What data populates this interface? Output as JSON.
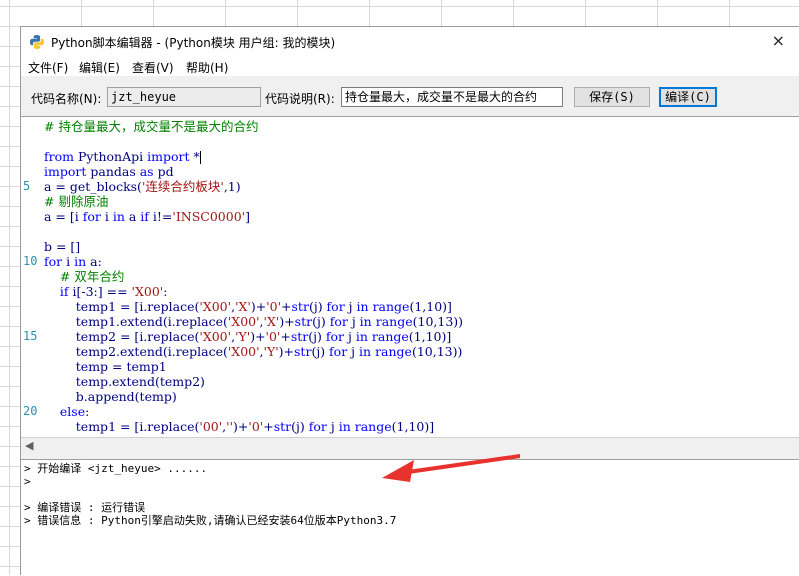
{
  "window": {
    "title": "Python脚本编辑器 - (Python模块 用户组: 我的模块)",
    "close_glyph": "×"
  },
  "menu": [
    "文件(F)",
    "编辑(E)",
    "查看(V)",
    "帮助(H)"
  ],
  "toolbar": {
    "name_label": "代码名称(N):",
    "name_value": "jzt_heyue",
    "desc_label": "代码说明(R):",
    "desc_value": "持仓量最大，成交量不是最大的合约",
    "save_label": "保存(S)",
    "compile_label": "编译(C)"
  },
  "editor": {
    "line_numbers": [
      {
        "n": "5",
        "row": 4
      },
      {
        "n": "10",
        "row": 9
      },
      {
        "n": "15",
        "row": 14
      },
      {
        "n": "20",
        "row": 19
      }
    ],
    "lines": [
      [
        {
          "c": "cm",
          "t": "# 持仓量最大，成交量不是最大的合约"
        }
      ],
      [],
      [
        {
          "c": "kw",
          "t": "from"
        },
        {
          "c": "txt",
          "t": " PythonApi "
        },
        {
          "c": "kw",
          "t": "import"
        },
        {
          "c": "txt",
          "t": " *"
        },
        {
          "c": "cur",
          "t": ""
        }
      ],
      [
        {
          "c": "kw",
          "t": "import"
        },
        {
          "c": "txt",
          "t": " pandas "
        },
        {
          "c": "kw",
          "t": "as"
        },
        {
          "c": "txt",
          "t": " pd"
        }
      ],
      [
        {
          "c": "txt",
          "t": "a = get_blocks("
        },
        {
          "c": "st",
          "t": "'连续合约板块'"
        },
        {
          "c": "txt",
          "t": ",1)"
        }
      ],
      [
        {
          "c": "cm",
          "t": "# 剔除原油"
        }
      ],
      [
        {
          "c": "txt",
          "t": "a = [i "
        },
        {
          "c": "kw",
          "t": "for"
        },
        {
          "c": "txt",
          "t": " i "
        },
        {
          "c": "kw",
          "t": "in"
        },
        {
          "c": "txt",
          "t": " a "
        },
        {
          "c": "kw",
          "t": "if"
        },
        {
          "c": "txt",
          "t": " i!="
        },
        {
          "c": "st",
          "t": "'INSC0000'"
        },
        {
          "c": "txt",
          "t": "]"
        }
      ],
      [],
      [
        {
          "c": "txt",
          "t": "b = []"
        }
      ],
      [
        {
          "c": "kw",
          "t": "for"
        },
        {
          "c": "txt",
          "t": " i "
        },
        {
          "c": "kw",
          "t": "in"
        },
        {
          "c": "txt",
          "t": " a:"
        }
      ],
      [
        {
          "c": "cm",
          "t": "    # 双年合约"
        }
      ],
      [
        {
          "c": "txt",
          "t": "    "
        },
        {
          "c": "kw",
          "t": "if"
        },
        {
          "c": "txt",
          "t": " i[-3:] == "
        },
        {
          "c": "st",
          "t": "'X00'"
        },
        {
          "c": "txt",
          "t": ":"
        }
      ],
      [
        {
          "c": "txt",
          "t": "        temp1 = [i.replace("
        },
        {
          "c": "st",
          "t": "'X00'"
        },
        {
          "c": "txt",
          "t": ","
        },
        {
          "c": "st",
          "t": "'X'"
        },
        {
          "c": "txt",
          "t": ")+"
        },
        {
          "c": "st",
          "t": "'0'"
        },
        {
          "c": "txt",
          "t": "+"
        },
        {
          "c": "kw",
          "t": "str"
        },
        {
          "c": "txt",
          "t": "(j) "
        },
        {
          "c": "kw",
          "t": "for"
        },
        {
          "c": "txt",
          "t": " j "
        },
        {
          "c": "kw",
          "t": "in"
        },
        {
          "c": "txt",
          "t": " "
        },
        {
          "c": "kw",
          "t": "range"
        },
        {
          "c": "txt",
          "t": "(1,10)]"
        }
      ],
      [
        {
          "c": "txt",
          "t": "        temp1.extend(i.replace("
        },
        {
          "c": "st",
          "t": "'X00'"
        },
        {
          "c": "txt",
          "t": ","
        },
        {
          "c": "st",
          "t": "'X'"
        },
        {
          "c": "txt",
          "t": ")+"
        },
        {
          "c": "kw",
          "t": "str"
        },
        {
          "c": "txt",
          "t": "(j) "
        },
        {
          "c": "kw",
          "t": "for"
        },
        {
          "c": "txt",
          "t": " j "
        },
        {
          "c": "kw",
          "t": "in"
        },
        {
          "c": "txt",
          "t": " "
        },
        {
          "c": "kw",
          "t": "range"
        },
        {
          "c": "txt",
          "t": "(10,13))"
        }
      ],
      [
        {
          "c": "txt",
          "t": "        temp2 = [i.replace("
        },
        {
          "c": "st",
          "t": "'X00'"
        },
        {
          "c": "txt",
          "t": ","
        },
        {
          "c": "st",
          "t": "'Y'"
        },
        {
          "c": "txt",
          "t": ")+"
        },
        {
          "c": "st",
          "t": "'0'"
        },
        {
          "c": "txt",
          "t": "+"
        },
        {
          "c": "kw",
          "t": "str"
        },
        {
          "c": "txt",
          "t": "(j) "
        },
        {
          "c": "kw",
          "t": "for"
        },
        {
          "c": "txt",
          "t": " j "
        },
        {
          "c": "kw",
          "t": "in"
        },
        {
          "c": "txt",
          "t": " "
        },
        {
          "c": "kw",
          "t": "range"
        },
        {
          "c": "txt",
          "t": "(1,10)]"
        }
      ],
      [
        {
          "c": "txt",
          "t": "        temp2.extend(i.replace("
        },
        {
          "c": "st",
          "t": "'X00'"
        },
        {
          "c": "txt",
          "t": ","
        },
        {
          "c": "st",
          "t": "'Y'"
        },
        {
          "c": "txt",
          "t": ")+"
        },
        {
          "c": "kw",
          "t": "str"
        },
        {
          "c": "txt",
          "t": "(j) "
        },
        {
          "c": "kw",
          "t": "for"
        },
        {
          "c": "txt",
          "t": " j "
        },
        {
          "c": "kw",
          "t": "in"
        },
        {
          "c": "txt",
          "t": " "
        },
        {
          "c": "kw",
          "t": "range"
        },
        {
          "c": "txt",
          "t": "(10,13))"
        }
      ],
      [
        {
          "c": "txt",
          "t": "        temp = temp1"
        }
      ],
      [
        {
          "c": "txt",
          "t": "        temp.extend(temp2)"
        }
      ],
      [
        {
          "c": "txt",
          "t": "        b.append(temp)"
        }
      ],
      [
        {
          "c": "txt",
          "t": "    "
        },
        {
          "c": "kw",
          "t": "else"
        },
        {
          "c": "txt",
          "t": ":"
        }
      ],
      [
        {
          "c": "txt",
          "t": "        temp1 = [i.replace("
        },
        {
          "c": "st",
          "t": "'00'"
        },
        {
          "c": "txt",
          "t": ","
        },
        {
          "c": "st",
          "t": "''"
        },
        {
          "c": "txt",
          "t": ")+"
        },
        {
          "c": "st",
          "t": "'0'"
        },
        {
          "c": "txt",
          "t": "+"
        },
        {
          "c": "kw",
          "t": "str"
        },
        {
          "c": "txt",
          "t": "(j) "
        },
        {
          "c": "kw",
          "t": "for"
        },
        {
          "c": "txt",
          "t": " j "
        },
        {
          "c": "kw",
          "t": "in"
        },
        {
          "c": "txt",
          "t": " "
        },
        {
          "c": "kw",
          "t": "range"
        },
        {
          "c": "txt",
          "t": "(1,10)]"
        }
      ]
    ]
  },
  "scrollbar": {
    "left_glyph": "◀"
  },
  "output": {
    "lines": [
      "> 开始编译 <jzt_heyue> ......",
      ">",
      "",
      "> 编译错误 : 运行错误",
      "> 错误信息 : Python引擎启动失败,请确认已经安装64位版本Python3.7"
    ]
  },
  "colors": {
    "keyword": "#0000ff",
    "comment": "#008000",
    "string": "#a31515",
    "arrow": "#e8322e"
  }
}
